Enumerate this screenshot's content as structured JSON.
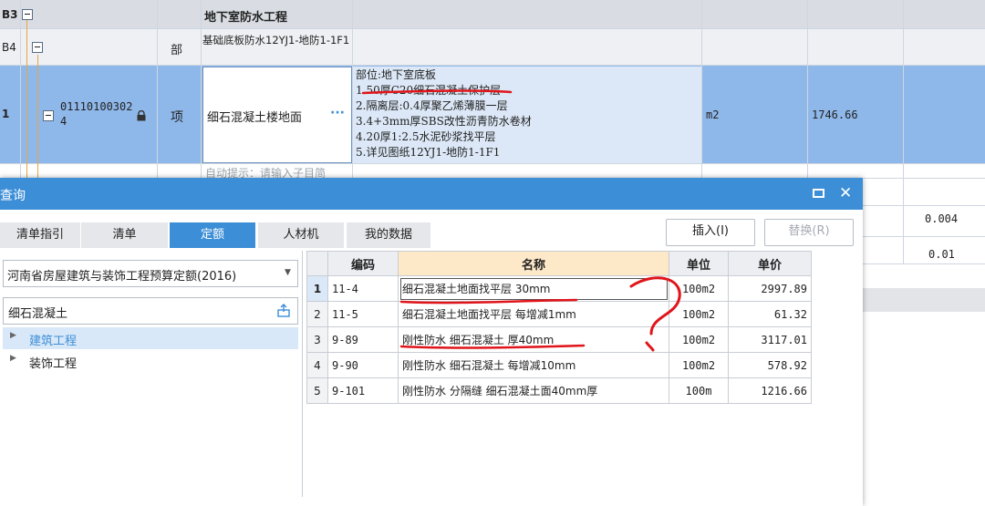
{
  "grid": {
    "row_b3": {
      "num": "B3",
      "title": "地下室防水工程"
    },
    "row_b4": {
      "num": "B4",
      "type": "部",
      "name": "基础底板防水12YJ1-地防1-1F1"
    },
    "row_1": {
      "num": "1",
      "code": "011101003024",
      "type": "项",
      "name": "细石混凝土楼地面",
      "ellipsis": "···",
      "features": [
        "部位:地下室底板",
        "1.50厚C20细石混凝土保护层",
        "2.隔离层:0.4厚聚乙烯薄膜一层",
        "3.4+3mm厚SBS改性沥青防水卷材",
        "4.20厚1:2.5水泥砂浆找平层",
        "5.详见图纸12YJ1-地防1-1F1"
      ],
      "unit": "m2",
      "quantity": "1746.66"
    },
    "row_hint": "自动提示：请输入子目简",
    "right_values": [
      "0.004",
      "0.01"
    ]
  },
  "dialog": {
    "title": "查询",
    "tabs": [
      "清单指引",
      "清单",
      "定额",
      "人材机",
      "我的数据"
    ],
    "active_tab": "定额",
    "insert_label": "插入(I)",
    "replace_label": "替换(R)",
    "quota_library": "河南省房屋建筑与装饰工程预算定额(2016)",
    "search_value": "细石混凝土",
    "tree": [
      "建筑工程",
      "装饰工程"
    ],
    "table": {
      "headers": [
        "编码",
        "名称",
        "单位",
        "单价"
      ],
      "rows": [
        {
          "idx": "1",
          "code": "11-4",
          "name": "细石混凝土地面找平层 30mm",
          "unit": "100m2",
          "price": "2997.89"
        },
        {
          "idx": "2",
          "code": "11-5",
          "name": "细石混凝土地面找平层 每增减1mm",
          "unit": "100m2",
          "price": "61.32"
        },
        {
          "idx": "3",
          "code": "9-89",
          "name": "刚性防水 细石混凝土 厚40mm",
          "unit": "100m2",
          "price": "3117.01"
        },
        {
          "idx": "4",
          "code": "9-90",
          "name": "刚性防水 细石混凝土 每增减10mm",
          "unit": "100m2",
          "price": "578.92"
        },
        {
          "idx": "5",
          "code": "9-101",
          "name": "刚性防水 分隔缝 细石混凝土面40mm厚",
          "unit": "100m",
          "price": "1216.66"
        }
      ]
    }
  },
  "colors": {
    "accent": "#3c8ed7",
    "selected_row": "#8fb8ea",
    "annotation": "#e0151b"
  }
}
